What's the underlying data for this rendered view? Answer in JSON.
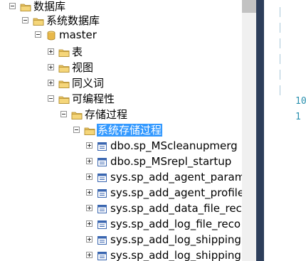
{
  "tree": {
    "nodes": [
      {
        "label": "数据库",
        "icon": "folder-icon",
        "expander": "minus"
      },
      {
        "label": "系统数据库",
        "icon": "folder-icon",
        "expander": "minus"
      },
      {
        "label": "master",
        "icon": "database-icon",
        "expander": "minus"
      },
      {
        "label": "表",
        "icon": "folder-icon",
        "expander": "plus"
      },
      {
        "label": "视图",
        "icon": "folder-icon",
        "expander": "plus"
      },
      {
        "label": "同义词",
        "icon": "folder-icon",
        "expander": "plus"
      },
      {
        "label": "可编程性",
        "icon": "folder-icon",
        "expander": "minus"
      },
      {
        "label": "存储过程",
        "icon": "folder-icon",
        "expander": "minus"
      },
      {
        "label": "系统存储过程",
        "icon": "folder-icon",
        "expander": "minus",
        "selected": true
      },
      {
        "label": "dbo.sp_MScleanupmerg",
        "icon": "stored-procedure-icon",
        "expander": "plus"
      },
      {
        "label": "dbo.sp_MSrepl_startup",
        "icon": "stored-procedure-icon",
        "expander": "plus"
      },
      {
        "label": "sys.sp_add_agent_param",
        "icon": "stored-procedure-icon",
        "expander": "plus"
      },
      {
        "label": "sys.sp_add_agent_profile",
        "icon": "stored-procedure-icon",
        "expander": "plus"
      },
      {
        "label": "sys.sp_add_data_file_reco",
        "icon": "stored-procedure-icon",
        "expander": "plus"
      },
      {
        "label": "sys.sp_add_log_file_reco",
        "icon": "stored-procedure-icon",
        "expander": "plus"
      },
      {
        "label": "sys.sp_add_log_shipping",
        "icon": "stored-procedure-icon",
        "expander": "plus"
      },
      {
        "label": "sys.sp_add_log_shipping",
        "icon": "stored-procedure-icon",
        "expander": "plus"
      }
    ]
  },
  "editor": {
    "line_numbers": [
      "10",
      "1"
    ]
  },
  "colors": {
    "selection": "#3399ff",
    "splitter": "#2d3e5a",
    "line_number": "#2b91af"
  }
}
